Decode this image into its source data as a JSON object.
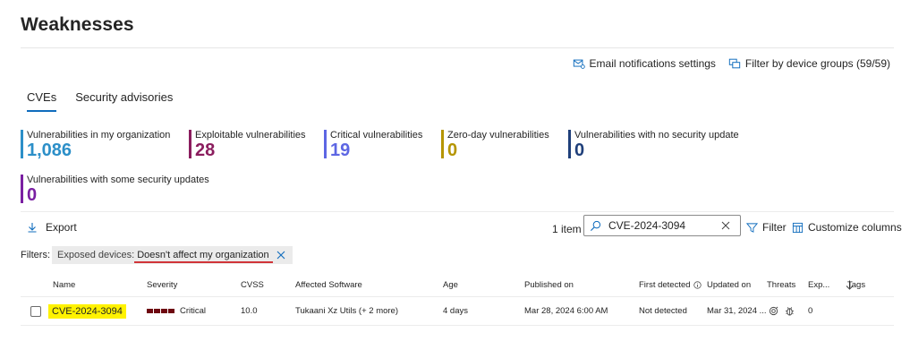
{
  "page": {
    "title": "Weaknesses"
  },
  "top_actions": {
    "email_label": "Email notifications settings",
    "filter_groups_label": "Filter by device groups (59/59)"
  },
  "tabs": [
    {
      "label": "CVEs",
      "active": true
    },
    {
      "label": "Security advisories",
      "active": false
    }
  ],
  "metrics": [
    {
      "label": "Vulnerabilities in my organization",
      "value": "1,086",
      "color": "#2c8fc8"
    },
    {
      "label": "Exploitable vulnerabilities",
      "value": "28",
      "color": "#8b1d5e"
    },
    {
      "label": "Critical vulnerabilities",
      "value": "19",
      "color": "#5d66e3"
    },
    {
      "label": "Zero-day vulnerabilities",
      "value": "0",
      "color": "#b59500"
    },
    {
      "label": "Vulnerabilities with no security update",
      "value": "0",
      "color": "#1f3f7a"
    },
    {
      "label": "Vulnerabilities with some security updates",
      "value": "0",
      "color": "#7a1fa2"
    }
  ],
  "toolbar": {
    "export_label": "Export",
    "item_count": "1 item",
    "search_value": "CVE-2024-3094",
    "filter_label": "Filter",
    "customize_label": "Customize columns"
  },
  "filters": {
    "label": "Filters:",
    "chip_key": "Exposed devices:",
    "chip_value": "Doesn't affect my organization"
  },
  "table": {
    "headers": {
      "name": "Name",
      "severity": "Severity",
      "cvss": "CVSS",
      "affected_software": "Affected Software",
      "age": "Age",
      "published_on": "Published on",
      "first_detected": "First detected",
      "updated_on": "Updated on",
      "threats": "Threats",
      "exposed": "Exp...",
      "tags": "Tags"
    },
    "rows": [
      {
        "name": "CVE-2024-3094",
        "severity": "Critical",
        "cvss": "10.0",
        "affected_software": "Tukaani Xz Utils (+ 2 more)",
        "age": "4 days",
        "published_on": "Mar 28, 2024 6:00 AM",
        "first_detected": "Not detected",
        "updated_on": "Mar 31, 2024 ...",
        "exposed": "0",
        "tags": ""
      }
    ]
  }
}
